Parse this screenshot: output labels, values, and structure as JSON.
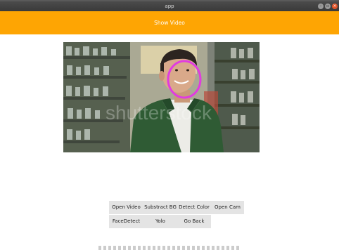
{
  "window": {
    "title": "app",
    "controls": [
      "minimize-icon",
      "maximize-icon",
      "close-icon"
    ]
  },
  "header": {
    "button_label": "Show Video",
    "color": "#fea503"
  },
  "video": {
    "watermark": "shutterstock",
    "overlay_color": "#e13be0"
  },
  "buttons": {
    "open_video": "Open Video",
    "subtract_bg": "Substract BG",
    "detect_color": "Detect Color",
    "open_cam": "Open Cam",
    "face_detect": "FaceDetect",
    "yolo": "Yolo",
    "go_back": "Go Back"
  }
}
